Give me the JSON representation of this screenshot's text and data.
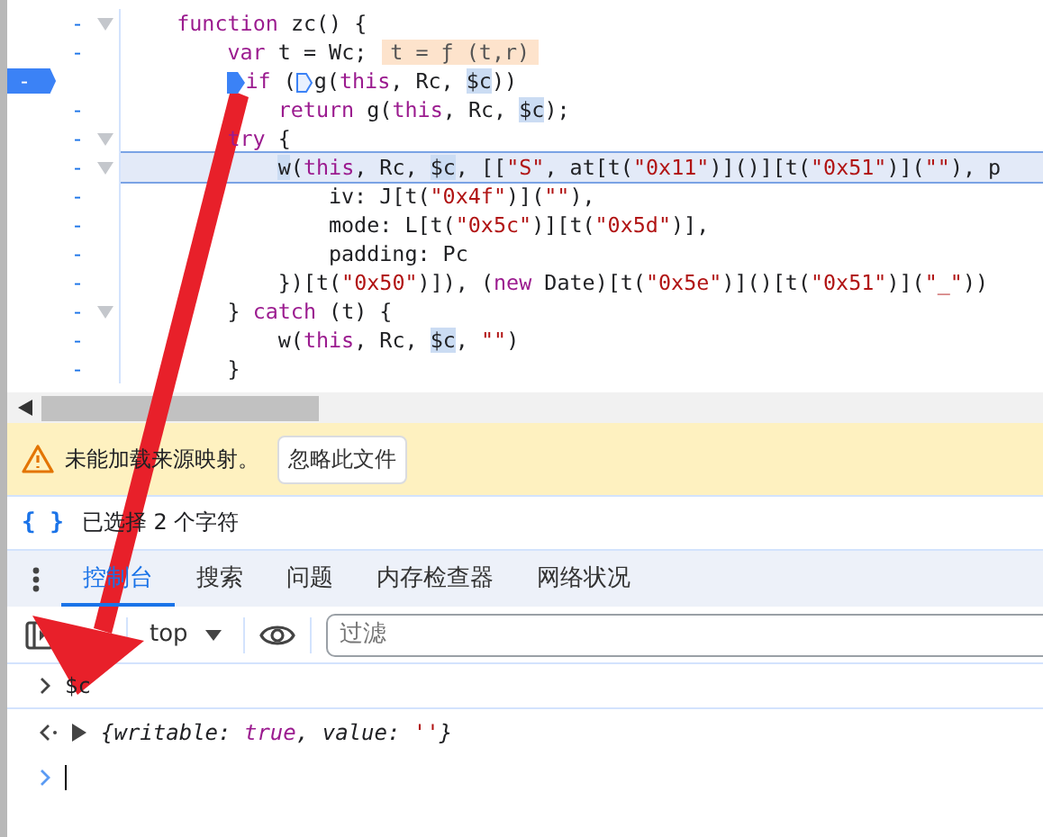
{
  "editor": {
    "lines": [
      {
        "marker": "-",
        "fold": true,
        "current": false,
        "highlighted": false,
        "tokens": [
          {
            "kind": "kw",
            "t": "function"
          },
          {
            "kind": "p",
            "t": " zc() {"
          }
        ],
        "children": [
          {
            "marker": "-",
            "fold": false,
            "current": false,
            "highlighted": false,
            "tokens": [
              {
                "kind": "kw",
                "t": "var"
              },
              {
                "kind": "p",
                "t": " t = Wc;"
              },
              {
                "kind": "iv",
                "t": "t = ƒ (t,r)"
              }
            ]
          },
          {
            "marker": "-",
            "fold": false,
            "current": true,
            "highlighted": false,
            "tokens": [
              {
                "kind": "bp"
              },
              {
                "kind": "kw",
                "t": "if"
              },
              {
                "kind": "p",
                "t": " ("
              },
              {
                "kind": "bpo"
              },
              {
                "kind": "p",
                "t": "g("
              },
              {
                "kind": "kw",
                "t": "this"
              },
              {
                "kind": "p",
                "t": ", Rc, "
              },
              {
                "kind": "m",
                "t": "$c"
              },
              {
                "kind": "p",
                "t": "))"
              }
            ],
            "children": [
              {
                "marker": "-",
                "fold": false,
                "current": false,
                "highlighted": false,
                "tokens": [
                  {
                    "kind": "kw",
                    "t": "return"
                  },
                  {
                    "kind": "p",
                    "t": " g("
                  },
                  {
                    "kind": "kw",
                    "t": "this"
                  },
                  {
                    "kind": "p",
                    "t": ", Rc, "
                  },
                  {
                    "kind": "m",
                    "t": "$c"
                  },
                  {
                    "kind": "p",
                    "t": ");"
                  }
                ]
              }
            ]
          },
          {
            "marker": "-",
            "fold": true,
            "current": false,
            "highlighted": false,
            "tokens": [
              {
                "kind": "kw",
                "t": "try"
              },
              {
                "kind": "p",
                "t": " {"
              }
            ],
            "children": [
              {
                "marker": "-",
                "fold": true,
                "current": false,
                "highlighted": true,
                "tokens": [
                  {
                    "kind": "m",
                    "t": "w"
                  },
                  {
                    "kind": "p",
                    "t": "("
                  },
                  {
                    "kind": "kw",
                    "t": "this"
                  },
                  {
                    "kind": "p",
                    "t": ", Rc, "
                  },
                  {
                    "kind": "m",
                    "t": "$c"
                  },
                  {
                    "kind": "p",
                    "t": ", [["
                  },
                  {
                    "kind": "s",
                    "t": "\"S\""
                  },
                  {
                    "kind": "p",
                    "t": ", at[t("
                  },
                  {
                    "kind": "s",
                    "t": "\"0x11\""
                  },
                  {
                    "kind": "p",
                    "t": ")]()][t("
                  },
                  {
                    "kind": "s",
                    "t": "\"0x51\""
                  },
                  {
                    "kind": "p",
                    "t": ")]("
                  },
                  {
                    "kind": "s",
                    "t": "\"\""
                  },
                  {
                    "kind": "p",
                    "t": "), p"
                  }
                ],
                "children": [
                  {
                    "marker": "-",
                    "fold": false,
                    "current": false,
                    "highlighted": false,
                    "tokens": [
                      {
                        "kind": "p",
                        "t": "iv: J[t("
                      },
                      {
                        "kind": "s",
                        "t": "\"0x4f\""
                      },
                      {
                        "kind": "p",
                        "t": ")]("
                      },
                      {
                        "kind": "s",
                        "t": "\"\""
                      },
                      {
                        "kind": "p",
                        "t": "),"
                      }
                    ]
                  },
                  {
                    "marker": "-",
                    "fold": false,
                    "current": false,
                    "highlighted": false,
                    "tokens": [
                      {
                        "kind": "p",
                        "t": "mode: L[t("
                      },
                      {
                        "kind": "s",
                        "t": "\"0x5c\""
                      },
                      {
                        "kind": "p",
                        "t": ")][t("
                      },
                      {
                        "kind": "s",
                        "t": "\"0x5d\""
                      },
                      {
                        "kind": "p",
                        "t": ")],"
                      }
                    ]
                  },
                  {
                    "marker": "-",
                    "fold": false,
                    "current": false,
                    "highlighted": false,
                    "tokens": [
                      {
                        "kind": "p",
                        "t": "padding: Pc"
                      }
                    ]
                  }
                ]
              },
              {
                "marker": "-",
                "fold": false,
                "current": false,
                "highlighted": false,
                "tokens": [
                  {
                    "kind": "p",
                    "t": "})[t("
                  },
                  {
                    "kind": "s",
                    "t": "\"0x50\""
                  },
                  {
                    "kind": "p",
                    "t": ")]), ("
                  },
                  {
                    "kind": "kw",
                    "t": "new"
                  },
                  {
                    "kind": "p",
                    "t": " Date)[t("
                  },
                  {
                    "kind": "s",
                    "t": "\"0x5e\""
                  },
                  {
                    "kind": "p",
                    "t": ")]()[t("
                  },
                  {
                    "kind": "s",
                    "t": "\"0x51\""
                  },
                  {
                    "kind": "p",
                    "t": ")]("
                  },
                  {
                    "kind": "s",
                    "t": "\"_\""
                  },
                  {
                    "kind": "p",
                    "t": "))"
                  }
                ]
              }
            ]
          },
          {
            "marker": "-",
            "fold": true,
            "current": false,
            "highlighted": false,
            "tokens": [
              {
                "kind": "p",
                "t": "} "
              },
              {
                "kind": "kw",
                "t": "catch"
              },
              {
                "kind": "p",
                "t": " (t) {"
              }
            ],
            "children": [
              {
                "marker": "-",
                "fold": false,
                "current": false,
                "highlighted": false,
                "tokens": [
                  {
                    "kind": "p",
                    "t": "w("
                  },
                  {
                    "kind": "kw",
                    "t": "this"
                  },
                  {
                    "kind": "p",
                    "t": ", Rc, "
                  },
                  {
                    "kind": "m",
                    "t": "$c"
                  },
                  {
                    "kind": "p",
                    "t": ", "
                  },
                  {
                    "kind": "s",
                    "t": "\"\""
                  },
                  {
                    "kind": "p",
                    "t": ")"
                  }
                ]
              }
            ]
          },
          {
            "marker": "-",
            "fold": false,
            "current": false,
            "highlighted": false,
            "tokens": [
              {
                "kind": "p",
                "t": "}"
              }
            ]
          }
        ]
      }
    ]
  },
  "warning": {
    "message": "未能加载来源映射。",
    "button": "忽略此文件"
  },
  "status": {
    "icon_text": "{ }",
    "text": "已选择 2 个字符"
  },
  "drawer_tabs": [
    {
      "label": "控制台",
      "selected": true
    },
    {
      "label": "搜索",
      "selected": false
    },
    {
      "label": "问题",
      "selected": false
    },
    {
      "label": "内存检查器",
      "selected": false
    },
    {
      "label": "网络状况",
      "selected": false
    }
  ],
  "console_toolbar": {
    "context": "top",
    "filter": {
      "placeholder": "过滤"
    }
  },
  "console": [
    {
      "kind": "input",
      "tokens": [
        {
          "kind": "p",
          "t": "$c"
        }
      ]
    },
    {
      "kind": "result",
      "tokens": [
        {
          "kind": "p",
          "t": "{writable: "
        },
        {
          "kind": "kw",
          "t": "true"
        },
        {
          "kind": "p",
          "t": ", value: "
        },
        {
          "kind": "s",
          "t": "''"
        },
        {
          "kind": "p",
          "t": "}"
        }
      ]
    },
    {
      "kind": "prompt"
    }
  ]
}
